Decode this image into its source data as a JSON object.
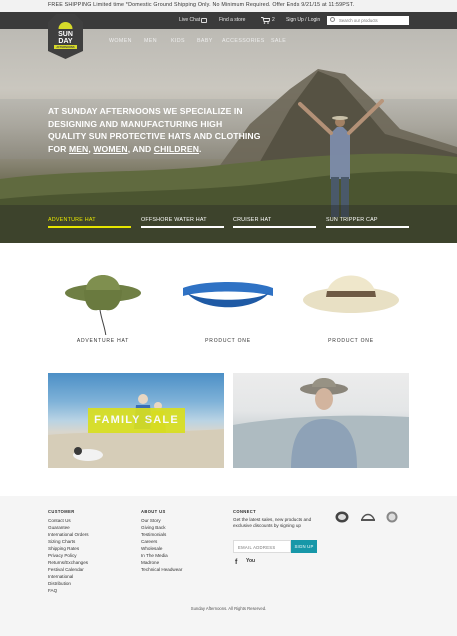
{
  "promo": {
    "text": "FREE SHIPPING Limited time   *Domestic Ground Shipping Only. No Minimum Required. Offer Ends 9/21/15 at 11:59PST."
  },
  "utility": {
    "live_chat": "Live Chat",
    "find_store": "Find a store",
    "cart_count": "2",
    "sign_in": "Sign Up / Login",
    "search_placeholder": "Search our products"
  },
  "logo": {
    "line1": "SUN",
    "line2": "DAY",
    "line3": "AFTERNOONS"
  },
  "nav": [
    "WOMEN",
    "MEN",
    "KIDS",
    "BABY",
    "ACCESSORIES",
    "SALE"
  ],
  "hero": {
    "headline_pre": "At Sunday Afternoons we specialize in designing and manufacturing high quality sun protective hats and clothing for ",
    "link_men": "men",
    "sep1": ", ",
    "link_women": "women",
    "sep2": ", and ",
    "link_children": "children",
    "end": ".",
    "tabs": [
      "ADVENTURE HAT",
      "OFFSHORE WATER HAT",
      "CRUISER HAT",
      "SUN TRIPPER CAP"
    ],
    "active_tab": 0
  },
  "products": [
    {
      "label": "ADVENTURE HAT"
    },
    {
      "label": "PRODUCT ONE"
    },
    {
      "label": "PRODUCT ONE"
    }
  ],
  "family_sale": {
    "label": "FAMILY SALE"
  },
  "footer": {
    "customer": {
      "heading": "CUSTOMER",
      "links": [
        "Contact Us",
        "Guarantee",
        "International Orders",
        "Sizing Charts",
        "Shipping Rates",
        "Privacy Policy",
        "Returns/Exchanges",
        "Festival Calendar",
        "International",
        "Distribution",
        "FAQ"
      ]
    },
    "about": {
      "heading": "ABOUT US",
      "links": [
        "Our Story",
        "Giving Back",
        "Testimonials",
        "Careers",
        "Wholesale",
        "In The Media",
        "Madrone",
        "Technical Headwear"
      ]
    },
    "connect": {
      "heading": "CONNECT",
      "text": "Get the latest sales, new products and exclusive discounts by signing up",
      "email_placeholder": "EMAIL ADDRESS",
      "signup_label": "SIGN UP",
      "facebook": "f",
      "youtube": "You"
    },
    "copyright": "Sunday Afternoons. All Rights Reserved."
  },
  "colors": {
    "accent_yellow": "#e6e600",
    "signup_teal": "#1797a8",
    "dark_bar": "#3b3b3b"
  }
}
